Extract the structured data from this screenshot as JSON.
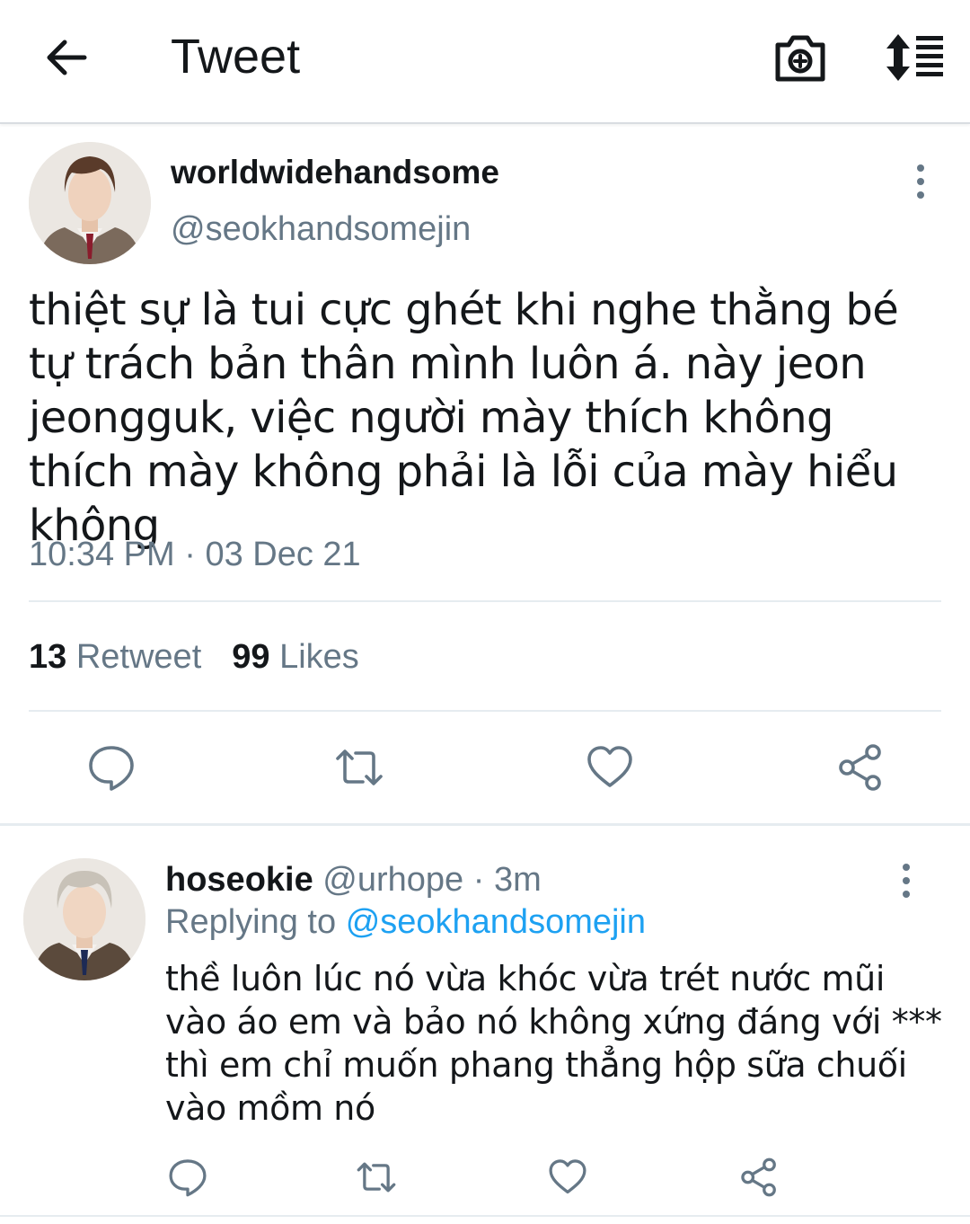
{
  "header": {
    "title": "Tweet",
    "back_icon": "arrow-left-icon",
    "camera_icon": "camera-add-icon",
    "sort_icon": "sort-lines-icon"
  },
  "tweet": {
    "display_name": "worldwidehandsome",
    "handle": "@seokhandsomejin",
    "text": "thiệt sự là tui cực ghét khi nghe thằng bé tự trách bản thân mình luôn á. này jeon jeongguk, việc người mày thích không thích mày không phải là lỗi của mày hiểu không",
    "time": "10:34 PM",
    "separator": "·",
    "date": "03 Dec 21",
    "retweet_count": "13",
    "retweet_label": "Retweet",
    "like_count": "99",
    "like_label": "Likes",
    "actions": [
      "reply-icon",
      "retweet-icon",
      "heart-icon",
      "share-icon"
    ]
  },
  "reply": {
    "display_name": "hoseokie",
    "handle": "@urhope",
    "separator": "·",
    "age": "3m",
    "replying_prefix": "Replying to",
    "replying_handle": "@seokhandsomejin",
    "text": "thề luôn lúc nó vừa khóc vừa trét nước mũi vào áo em và bảo nó không xứng đáng với *** thì em chỉ muốn phang thẳng hộp sữa chuối vào mồm nó"
  },
  "colors": {
    "text_primary": "#14171a",
    "text_secondary": "#657786",
    "accent": "#1da1f2",
    "divider": "#e6ecf0"
  }
}
